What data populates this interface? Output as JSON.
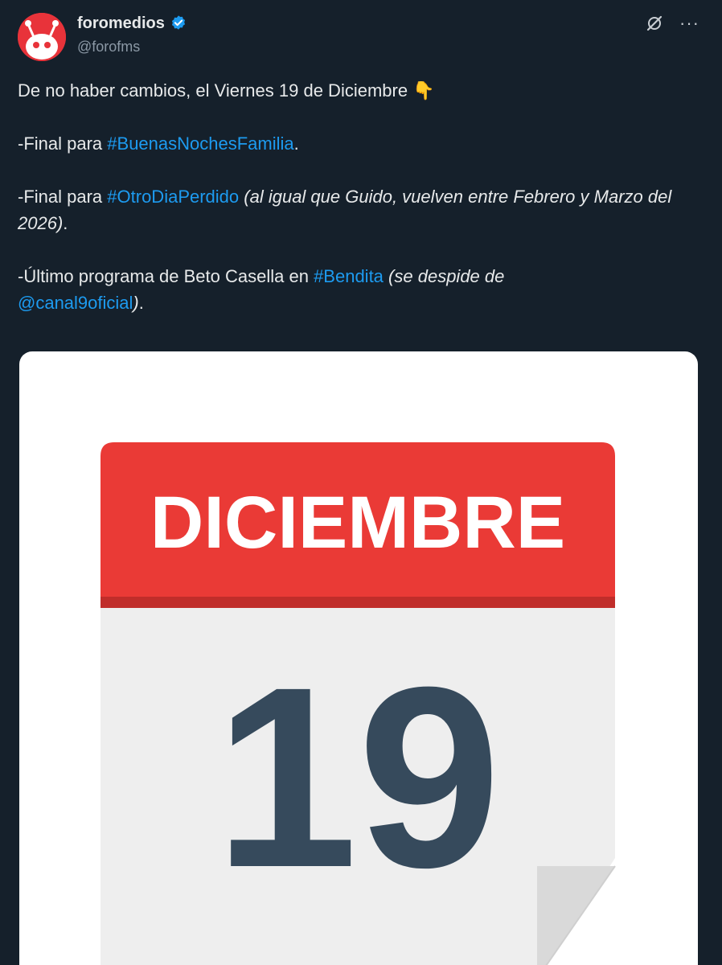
{
  "author": {
    "display_name": "foromedios",
    "handle": "@forofms",
    "verified_icon": "verified-badge-icon",
    "avatar_icon": "alien-logo-icon"
  },
  "actions": {
    "grok_icon": "grok-icon",
    "more_label": "···"
  },
  "tweet": {
    "line1": "De no haber cambios, el Viernes 19 de Diciembre",
    "emoji": "👇",
    "p2_prefix": "-Final para ",
    "p2_tag": "#BuenasNochesFamilia",
    "p2_suffix": ".",
    "p3_prefix": "-Final para ",
    "p3_tag": "#OtroDiaPerdido",
    "p3_italic": "(al igual que Guido, vuelven entre Febrero y Marzo del 2026)",
    "p3_suffix": ".",
    "p4_prefix": "-Último programa de Beto Casella en ",
    "p4_tag": "#Bendita",
    "p4_italic_a": "(se despide de",
    "p4_mention": "@canal9oficial",
    "p4_italic_b": ")",
    "p4_suffix": "."
  },
  "media": {
    "month": "DICIEMBRE",
    "day": "19",
    "colors": {
      "header_red": "#ea3a36",
      "header_shadow": "#c02d2a",
      "page": "#eeeeee",
      "digits": "#364a5c"
    }
  },
  "colors": {
    "background": "#15202b",
    "link": "#1d9bf0",
    "secondary_text": "#8b98a5"
  }
}
